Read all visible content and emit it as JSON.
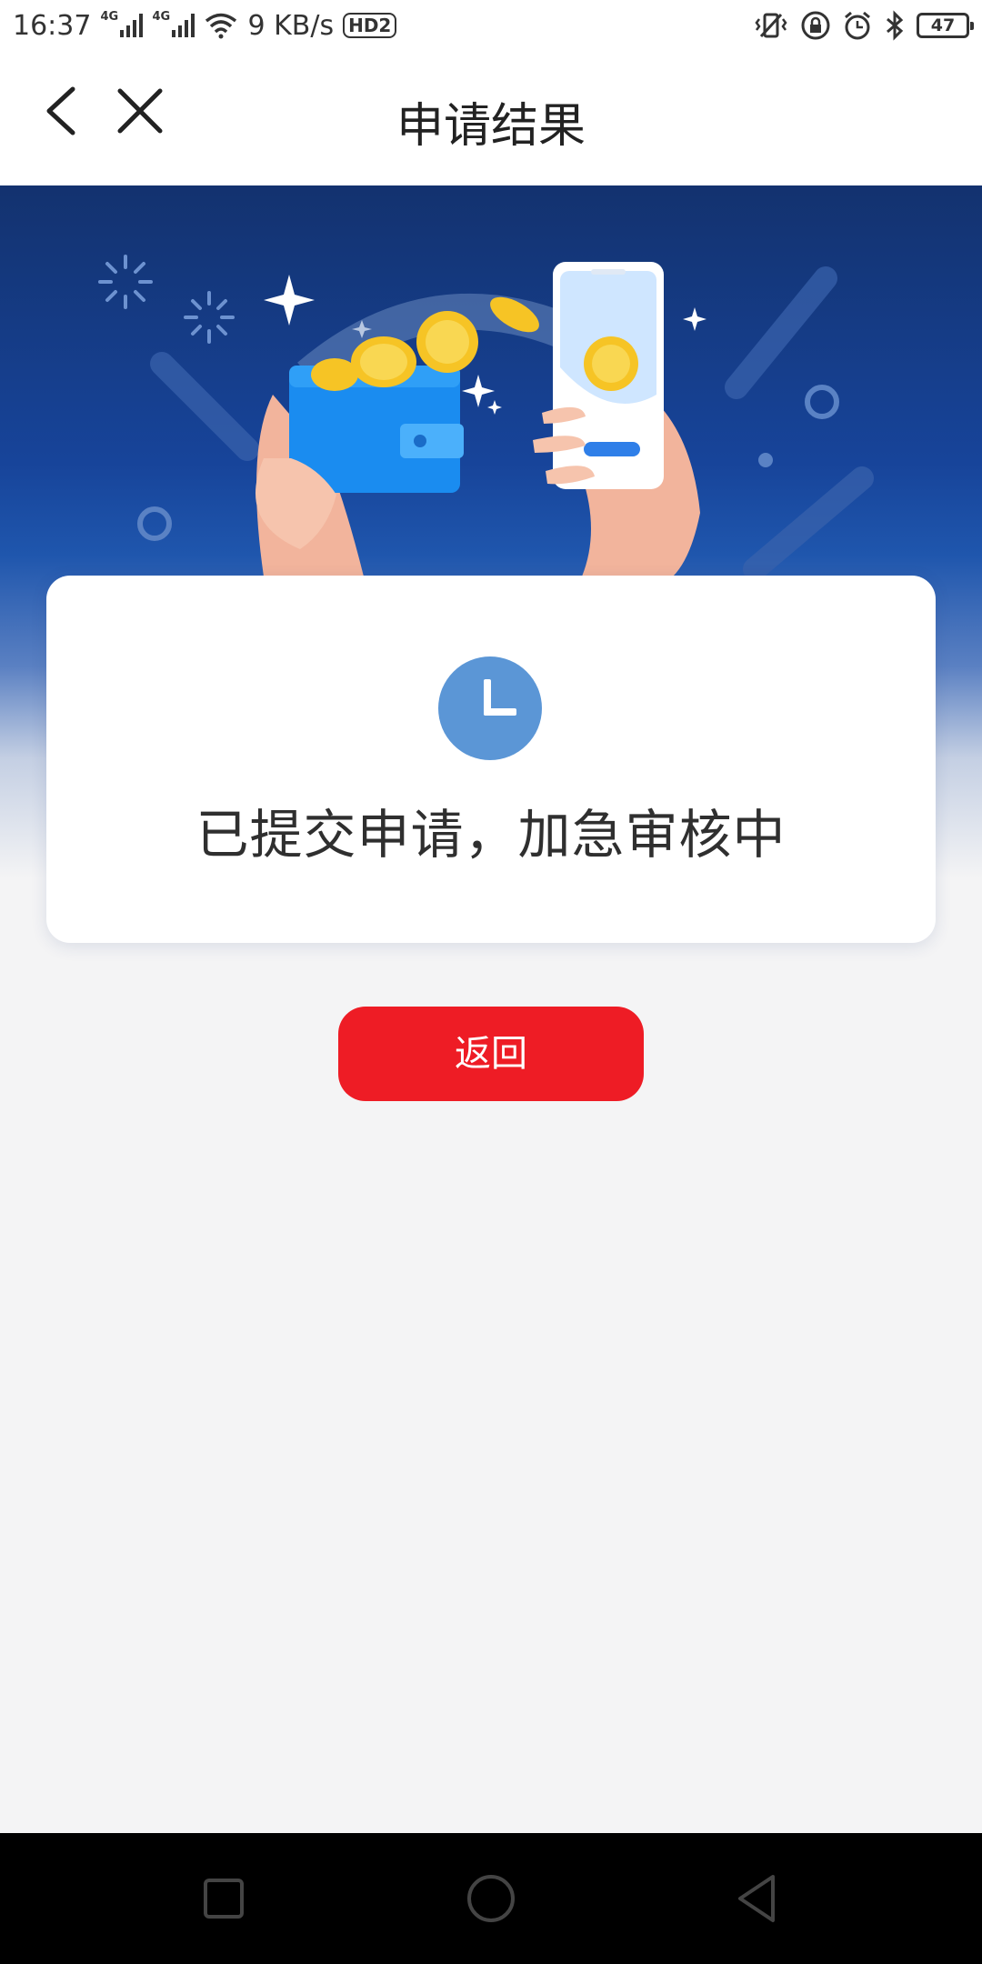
{
  "status_bar": {
    "time": "16:37",
    "network_type_1": "4G",
    "network_type_2": "4G",
    "net_speed": "9 KB/s",
    "hd_label": "HD2",
    "battery_level": "47"
  },
  "nav": {
    "title": "申请结果"
  },
  "result": {
    "message": "已提交申请，加急审核中"
  },
  "actions": {
    "return_label": "返回"
  },
  "colors": {
    "accent": "#ee1c25",
    "clock": "#5b96d6",
    "hero_dark": "#13326f"
  },
  "icons": [
    "back-icon",
    "close-icon",
    "clock-icon",
    "wifi-icon",
    "signal-icon",
    "vibrate-icon",
    "lock-icon",
    "alarm-icon",
    "bluetooth-icon",
    "battery-icon",
    "recent-apps-icon",
    "home-icon",
    "system-back-icon"
  ]
}
